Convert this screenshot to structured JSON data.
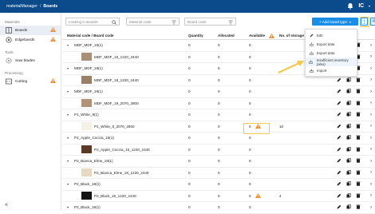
{
  "topbar": {
    "app_name": "materialManager",
    "separator": "/",
    "current_page": "Boards",
    "brand": "IC"
  },
  "sidebar": {
    "sections": [
      {
        "label": "Materials",
        "items": [
          {
            "label": "Boards",
            "active": true,
            "warning": true
          },
          {
            "label": "Edgebands",
            "active": false,
            "warning": true
          }
        ]
      },
      {
        "label": "Tools",
        "items": [
          {
            "label": "Saw blades",
            "active": false,
            "warning": false
          }
        ]
      },
      {
        "label": "Processing",
        "items": [
          {
            "label": "Cutting",
            "active": false,
            "warning": true
          }
        ]
      }
    ],
    "collapse_glyph": "«"
  },
  "toolbar": {
    "search_placeholder": "Looking in Boards",
    "material_code_placeholder": "Material code",
    "board_code_placeholder": "Board code",
    "add_button_label": "+ Add board type",
    "kebab_glyph": "⋮"
  },
  "menu": {
    "items": [
      "Edit",
      "Export data",
      "Export data",
      "Insufficient inventory (also)",
      "Import"
    ]
  },
  "table": {
    "headers": {
      "name": "Material code / Board code",
      "quantity": "Quantity",
      "allocated": "Allocated",
      "available": "Available",
      "storage": "No. of storage"
    },
    "rows": [
      {
        "type": "group",
        "name": "MDF_MDF_15(1)",
        "qty": "0",
        "alloc": "0",
        "avail": "0",
        "stor": ""
      },
      {
        "type": "child",
        "name": "MDF_MDF_15_1220_2440",
        "qty": "0",
        "alloc": "0",
        "avail": "0",
        "stor": "",
        "swatch": "#a88f78"
      },
      {
        "type": "group",
        "name": "MDF_MDF_18(1)",
        "qty": "0",
        "alloc": "0",
        "avail": "0",
        "stor": ""
      },
      {
        "type": "child",
        "name": "MDF_MDF_18_1220_2440",
        "qty": "0",
        "alloc": "0",
        "avail": "0",
        "stor": "",
        "swatch": "#9a7f67"
      },
      {
        "type": "group",
        "name": "MDF_MDF_19(1)",
        "qty": "0",
        "alloc": "0",
        "avail": "0",
        "stor": ""
      },
      {
        "type": "child",
        "name": "MDF_MDF_19_2070_2800",
        "qty": "0",
        "alloc": "0",
        "avail": "0",
        "stor": "",
        "swatch": "#b29379"
      },
      {
        "type": "group",
        "name": "P1_White_8(1)",
        "qty": "0",
        "alloc": "0",
        "avail": "0",
        "stor": ""
      },
      {
        "type": "child",
        "name": "P1_White_8_2070_2800",
        "qty": "0",
        "alloc": "0",
        "avail": "0",
        "stor": "10",
        "swatch": "#f4f1e6",
        "warning": true
      },
      {
        "type": "group",
        "name": "P2_Apple_Coccia_15(1)",
        "qty": "0",
        "alloc": "0",
        "avail": "0",
        "stor": ""
      },
      {
        "type": "child",
        "name": "P2_Apple_Coccia_15_1220_2440",
        "qty": "0",
        "alloc": "0",
        "avail": "0",
        "stor": "",
        "swatch": "#5a3a26"
      },
      {
        "type": "group",
        "name": "P2_Bianca_Elme_18(1)",
        "qty": "0",
        "alloc": "0",
        "avail": "0",
        "stor": ""
      },
      {
        "type": "child",
        "name": "P2_Bianca_Elme_18_1220_2440",
        "qty": "0",
        "alloc": "0",
        "avail": "0",
        "stor": "",
        "swatch": "#e6d8c2"
      },
      {
        "type": "group",
        "name": "P2_Black_18(1)",
        "qty": "0",
        "alloc": "0",
        "avail": "0",
        "stor": ""
      },
      {
        "type": "child",
        "name": "P2_Black_18_1220_2440",
        "qty": "0",
        "alloc": "0",
        "avail": "0",
        "stor": "4",
        "swatch": "#151515",
        "warning": true
      },
      {
        "type": "group",
        "name": "P2_Black_16(1)",
        "qty": "0",
        "alloc": "0",
        "avail": "0",
        "stor": ""
      }
    ]
  },
  "colors": {
    "topbar": "#0b4a8b",
    "primary": "#1a8ee6",
    "warning": "#f08a24",
    "highlight": "#f2c94c"
  }
}
